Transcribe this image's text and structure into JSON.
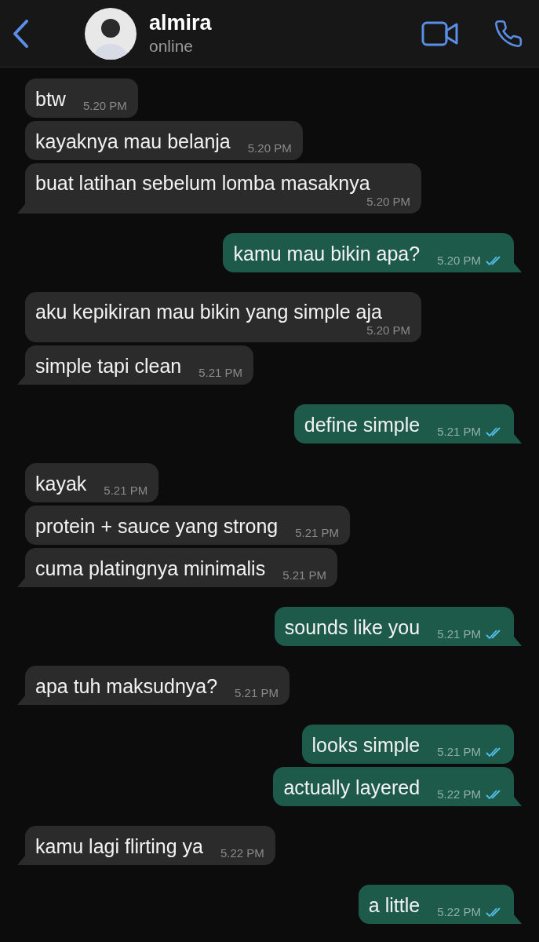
{
  "header": {
    "name": "almira",
    "status": "online"
  },
  "messages": [
    {
      "kind": "incoming",
      "text": "btw",
      "time": "5.20 PM"
    },
    {
      "kind": "incoming",
      "text": "kayaknya mau belanja",
      "time": "5.20 PM"
    },
    {
      "kind": "incoming",
      "text": "buat latihan sebelum lomba masaknya",
      "time": "5.20 PM"
    },
    {
      "kind": "outgoing",
      "text": "kamu mau bikin apa?",
      "time": "5.20 PM",
      "read": true
    },
    {
      "kind": "incoming",
      "text": "aku kepikiran mau bikin yang simple aja",
      "time": "5.20 PM"
    },
    {
      "kind": "incoming",
      "text": "simple tapi clean",
      "time": "5.21 PM"
    },
    {
      "kind": "outgoing",
      "text": "define simple",
      "time": "5.21 PM",
      "read": true
    },
    {
      "kind": "incoming",
      "text": "kayak",
      "time": "5.21 PM"
    },
    {
      "kind": "incoming",
      "text": "protein + sauce yang strong",
      "time": "5.21 PM"
    },
    {
      "kind": "incoming",
      "text": "cuma platingnya minimalis",
      "time": "5.21 PM"
    },
    {
      "kind": "outgoing",
      "text": "sounds like you",
      "time": "5.21 PM",
      "read": true
    },
    {
      "kind": "incoming",
      "text": "apa tuh maksudnya?",
      "time": "5.21 PM"
    },
    {
      "kind": "outgoing",
      "text": "looks simple",
      "time": "5.21 PM",
      "read": true
    },
    {
      "kind": "outgoing",
      "text": "actually layered",
      "time": "5.22 PM",
      "read": true
    },
    {
      "kind": "incoming",
      "text": "kamu lagi flirting ya",
      "time": "5.22 PM"
    },
    {
      "kind": "outgoing",
      "text": "a little",
      "time": "5.22 PM",
      "read": true
    }
  ]
}
